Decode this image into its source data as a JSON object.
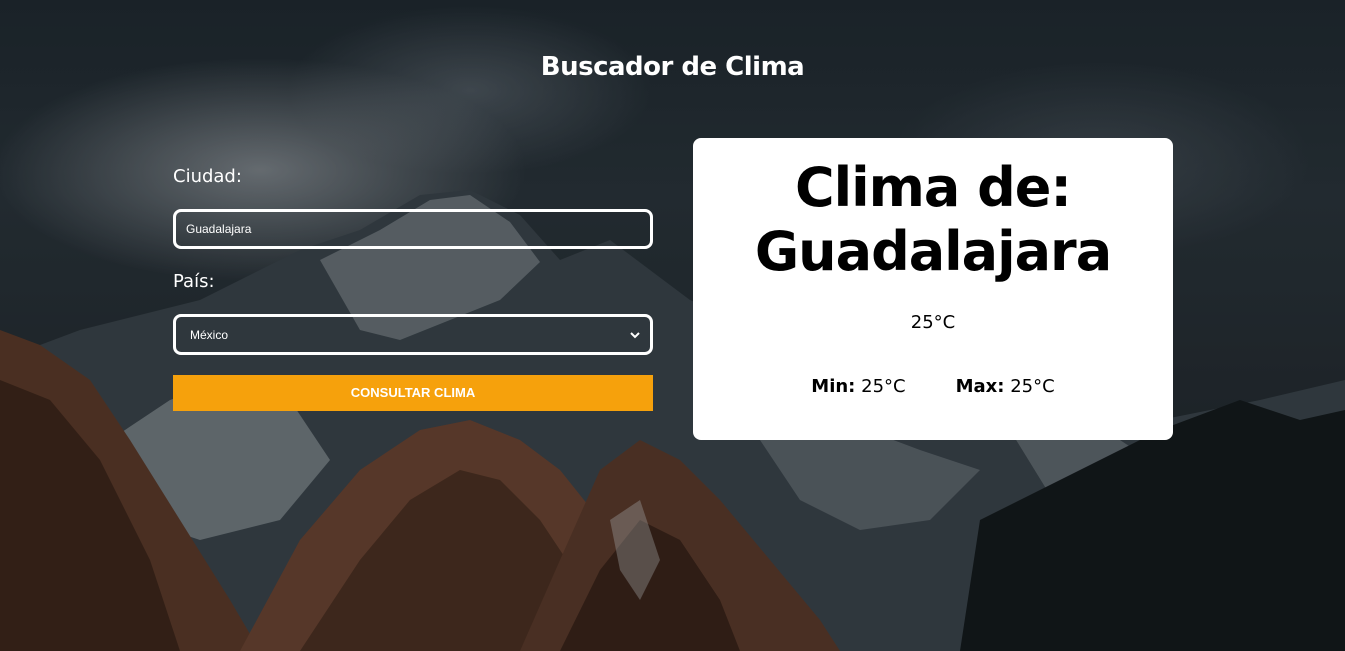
{
  "page": {
    "title": "Buscador de Clima"
  },
  "form": {
    "city_label": "Ciudad:",
    "city_value": "Guadalajara",
    "country_label": "País:",
    "country_selected": "México",
    "submit_label": "CONSULTAR CLIMA"
  },
  "result": {
    "heading": "Clima de: Guadalajara",
    "current_temp": "25°C",
    "min_label": "Min:",
    "min_value": "25°C",
    "max_label": "Max:",
    "max_value": "25°C"
  },
  "colors": {
    "accent": "#f6a10c",
    "card_bg": "#ffffff",
    "text_light": "#ffffff"
  },
  "icons": {
    "select_arrow": "chevron-down-icon"
  }
}
